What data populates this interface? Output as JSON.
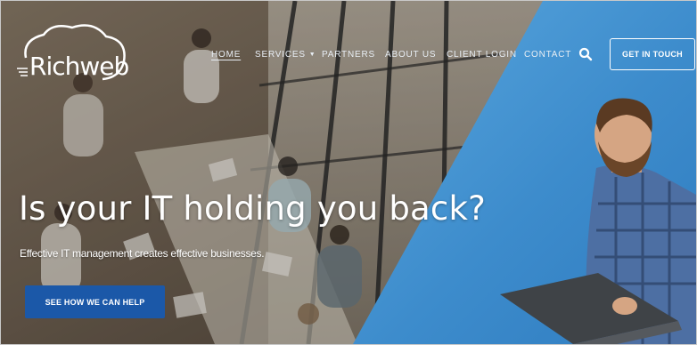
{
  "brand": {
    "name": "Richweb"
  },
  "nav": {
    "items": [
      {
        "label": "HOME",
        "active": true
      },
      {
        "label": "SERVICES",
        "has_dropdown": true
      },
      {
        "label": "PARTNERS"
      },
      {
        "label": "ABOUT US"
      },
      {
        "label": "CLIENT LOGIN"
      },
      {
        "label": "CONTACT"
      }
    ],
    "search_icon": "search-icon",
    "cta_label": "GET IN TOUCH"
  },
  "hero": {
    "headline": "Is your IT holding you back?",
    "subheadline": "Effective IT management creates effective businesses.",
    "cta_label": "SEE HOW WE CAN HELP"
  },
  "colors": {
    "accent_blue": "#1b58a8",
    "panel_blue": "#3f8fd0",
    "text_white": "#ffffff"
  }
}
